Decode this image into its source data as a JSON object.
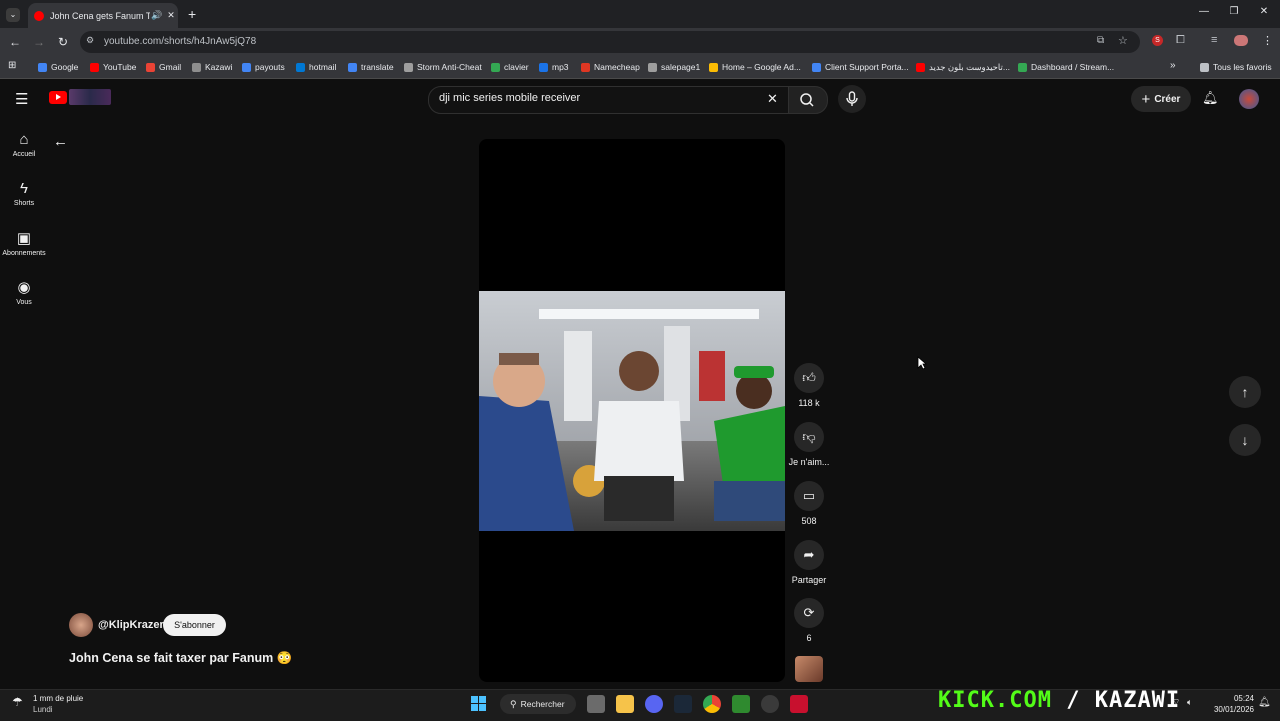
{
  "browser": {
    "tab_title": "John Cena gets Fanum Tax...",
    "url": "youtube.com/shorts/h4JnAw5jQ78",
    "bookmarks": [
      {
        "label": "Google",
        "color": "#4285f4"
      },
      {
        "label": "YouTube",
        "color": "#ff0000"
      },
      {
        "label": "Gmail",
        "color": "#ea4335"
      },
      {
        "label": "Kazawi",
        "color": "#8e8e8e"
      },
      {
        "label": "payouts",
        "color": "#4285f4"
      },
      {
        "label": "hotmail",
        "color": "#0078d4"
      },
      {
        "label": "translate",
        "color": "#4285f4"
      },
      {
        "label": "Storm Anti-Cheat",
        "color": "#9e9e9e"
      },
      {
        "label": "clavier",
        "color": "#34a853"
      },
      {
        "label": "mp3",
        "color": "#1a73e8"
      },
      {
        "label": "Namecheap",
        "color": "#de3723"
      },
      {
        "label": "salepage1",
        "color": "#9e9e9e"
      },
      {
        "label": "Home – Google Ad...",
        "color": "#fbbc04"
      },
      {
        "label": "Client Support Porta...",
        "color": "#4285f4"
      },
      {
        "label": "تاحيدوست بلون جديد...",
        "color": "#ff0000"
      },
      {
        "label": "Dashboard / Stream...",
        "color": "#34a853"
      }
    ],
    "all_bookmarks": "Tous les favoris"
  },
  "youtube": {
    "search_query": "dji mic series mobile receiver",
    "create_label": "Créer",
    "sidebar": [
      {
        "label": "Accueil",
        "icon": "home-icon"
      },
      {
        "label": "Shorts",
        "icon": "shorts-icon"
      },
      {
        "label": "Abonnements",
        "icon": "subscriptions-icon"
      },
      {
        "label": "Vous",
        "icon": "you-icon"
      }
    ],
    "actions": {
      "likes": "118 k",
      "dislike": "Je n'aim...",
      "comments": "508",
      "share": "Partager",
      "remix": "6"
    },
    "channel": "@KlipKrazer",
    "subscribe_label": "S'abonner",
    "video_title": "John Cena se fait taxer par Fanum 😳"
  },
  "taskbar": {
    "weather": "1 mm de pluie",
    "weather_day": "Lundi",
    "search_label": "Rechercher",
    "time": "05:24",
    "date": "30/01/2026",
    "kick_green": "KICK.COM",
    "kick_white": " / KAZAWI"
  },
  "colors": {
    "background": "#0f0f0f",
    "kick_green": "#53fc18",
    "yt_red": "#ff0000"
  }
}
